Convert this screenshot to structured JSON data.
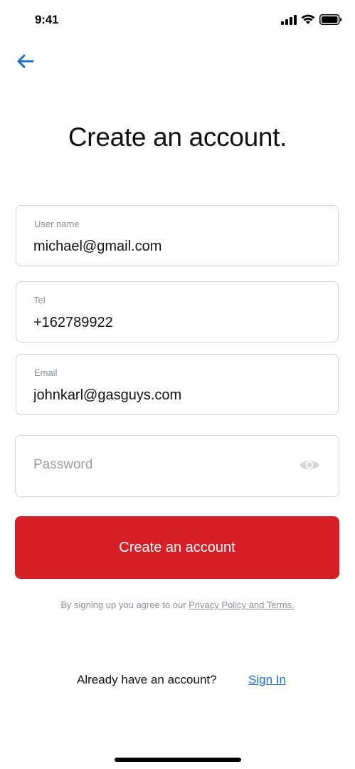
{
  "status_bar": {
    "time": "9:41"
  },
  "header": {
    "back_icon": "arrow-left-icon",
    "title": "Create an account."
  },
  "form": {
    "username": {
      "label": "User name",
      "value": "michael@gmail.com"
    },
    "tel": {
      "label": "Tel",
      "value": "+162789922"
    },
    "email": {
      "label": "Email",
      "value": "johnkarl@gasguys.com"
    },
    "password": {
      "placeholder": "Password",
      "value": "",
      "toggle_icon": "eye-icon"
    },
    "submit_label": "Create an account"
  },
  "terms": {
    "prefix": "By signing up you agree to our ",
    "link_text": "Privacy Policy and Terms."
  },
  "footer": {
    "prompt": "Already have an account?",
    "link": "Sign In"
  },
  "colors": {
    "primary": "#d71f27",
    "link": "#1a6fd1",
    "back_arrow": "#1a6fd1"
  }
}
